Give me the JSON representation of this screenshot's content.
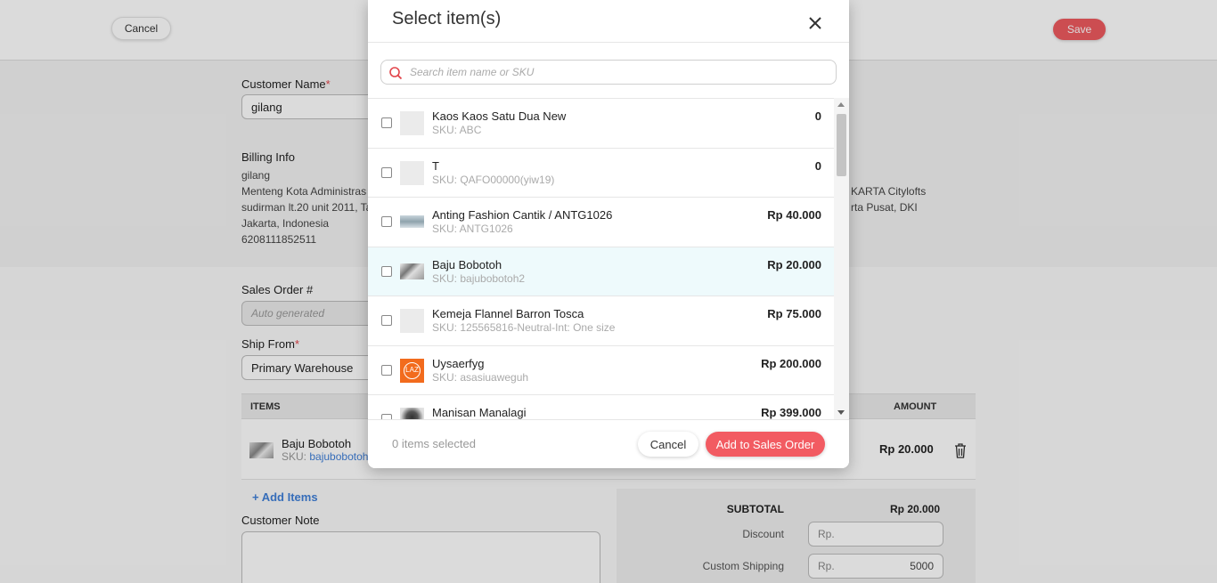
{
  "topbar": {
    "cancel_label": "Cancel",
    "save_label": "Save"
  },
  "form": {
    "customer_name_label": "Customer Name",
    "required_mark": "*",
    "customer_name_value": "gilang",
    "billing_label": "Billing Info",
    "billing_lines": [
      "gilang",
      "Menteng Kota Administras",
      "sudirman lt.20 unit 2011, Ta",
      "Jakarta, Indonesia",
      "6208111852511"
    ],
    "right_address_lines": [
      "KARTA Citylofts",
      "rta Pusat, DKI"
    ],
    "sales_order_label": "Sales Order #",
    "sales_order_placeholder": "Auto generated",
    "ship_from_label": "Ship From",
    "ship_from_value": "Primary Warehouse"
  },
  "items_table": {
    "col_items": "ITEMS",
    "col_amount": "AMOUNT",
    "row": {
      "name": "Baju Bobotoh",
      "sku_prefix": "SKU:",
      "sku_value": "bajubobotoh",
      "amount": "Rp 20.000"
    }
  },
  "add_items_label": "+ Add Items",
  "customer_note_label": "Customer Note",
  "summary": {
    "subtotal_label": "SUBTOTAL",
    "subtotal_value": "Rp 20.000",
    "discount_label": "Discount",
    "discount_placeholder": "Rp.",
    "shipping_label": "Custom Shipping",
    "shipping_prefix": "Rp.",
    "shipping_value": "5000"
  },
  "modal": {
    "title": "Select item(s)",
    "search_placeholder": "Search item name or SKU",
    "items": [
      {
        "name": "Kaos Kaos Satu Dua New",
        "sku": "SKU: ABC",
        "price": "0",
        "thumb": "blank"
      },
      {
        "name": "T",
        "sku": "SKU: QAFO00000(yiw19)",
        "price": "0",
        "thumb": "blank"
      },
      {
        "name": "Anting Fashion Cantik / ANTG1026",
        "sku": "SKU: ANTG1026",
        "price": "Rp 40.000",
        "thumb": "photo"
      },
      {
        "name": "Baju Bobotoh",
        "sku": "SKU: bajubobotoh2",
        "price": "Rp 20.000",
        "thumb": "photo"
      },
      {
        "name": "Kemeja Flannel Barron Tosca",
        "sku": "SKU: 125565816-Neutral-Int: One size",
        "price": "Rp 75.000",
        "thumb": "blank"
      },
      {
        "name": "Uysaerfyg",
        "sku": "SKU: asasiuaweguh",
        "price": "Rp 200.000",
        "thumb": "lazada-logo"
      },
      {
        "name": "Manisan Manalagi",
        "sku": "",
        "price": "Rp 399.000",
        "thumb": "photo"
      }
    ],
    "selected_count": "0 items selected",
    "cancel_label": "Cancel",
    "add_label": "Add to Sales Order",
    "thumb_logo_text": "LAZ"
  },
  "colors": {
    "accent": "#f25b62",
    "link": "#3f7fd8",
    "highlight_row": "#eefafc"
  }
}
